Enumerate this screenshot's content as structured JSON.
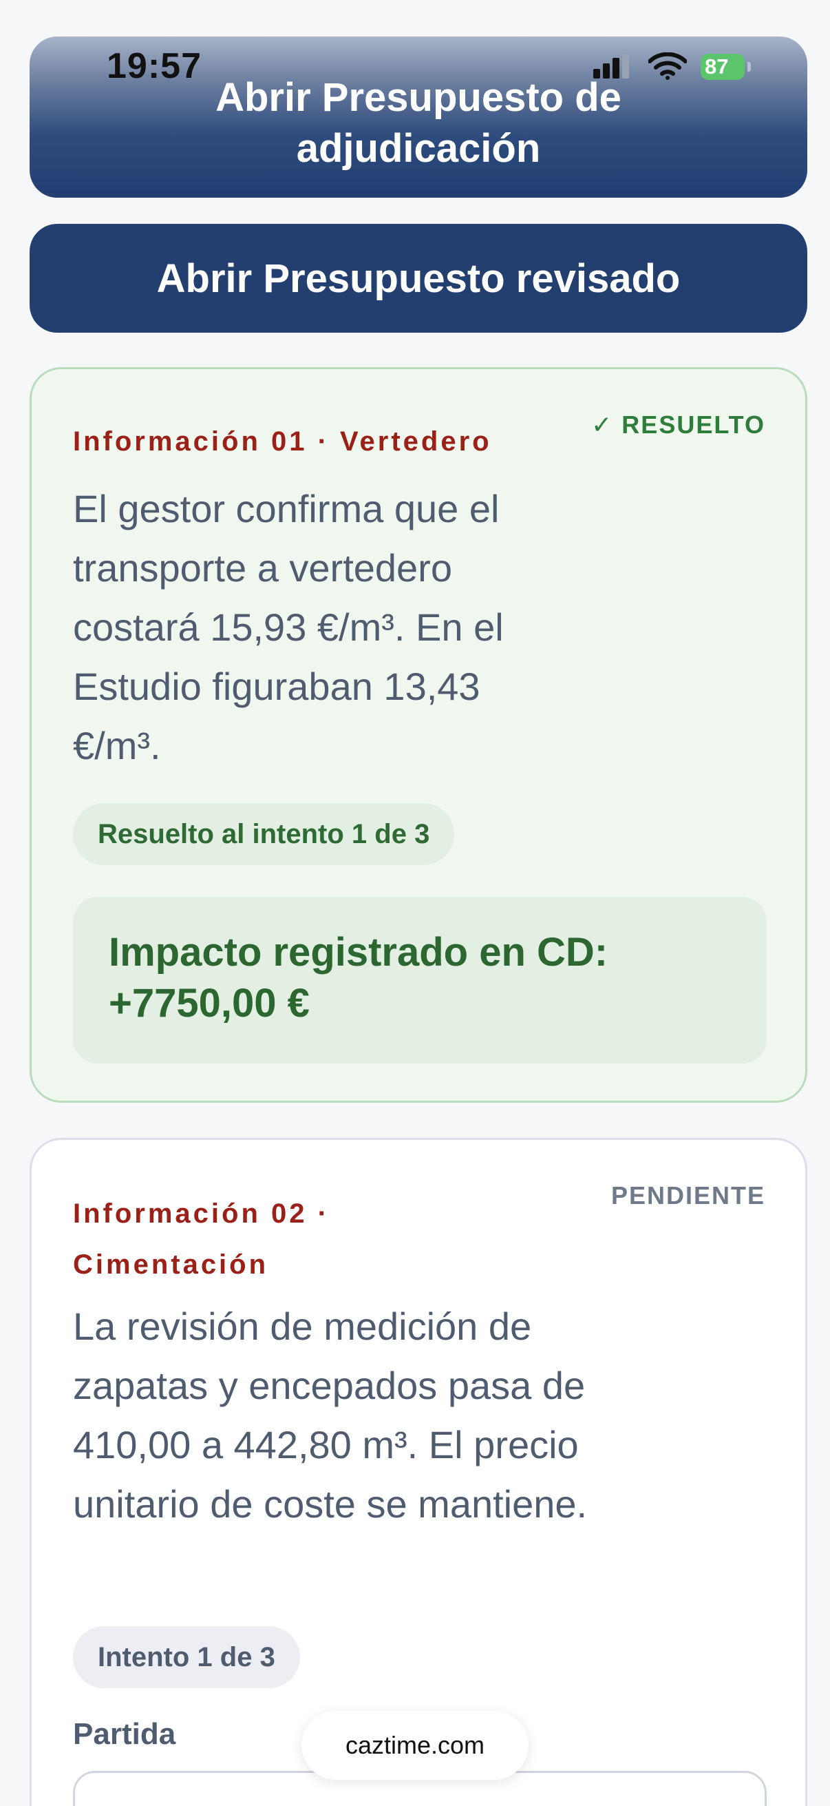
{
  "status_bar": {
    "time": "19:57",
    "battery": "87"
  },
  "buttons": {
    "open_adjudication": "Abrir Presupuesto de adjudicación",
    "open_revised": "Abrir Presupuesto revisado"
  },
  "cards": [
    {
      "kicker": "Información 01 · Vertedero",
      "status": "✓ RESUELTO",
      "body": "El gestor confirma que el transporte a vertedero costará 15,93 €/m³. En el Estudio figuraban 13,43 €/m³.",
      "attempt": "Resuelto al intento 1 de 3",
      "impact_line1": "Impacto registrado en CD:",
      "impact_line2": "+7750,00 €"
    },
    {
      "kicker": "Información 02 · Cimentación",
      "status": "PENDIENTE",
      "body": "La revisión de medición de zapatas y encepados pasa de 410,00 a 442,80 m³. El precio unitario de coste se mantiene.",
      "attempt": "Intento 1 de 3",
      "field_label": "Partida"
    }
  ],
  "browser": {
    "url": "caztime.com"
  },
  "colors": {
    "primary_navy": "#233f6f",
    "resolved_green": "#2e7d3a",
    "kicker_red": "#9a2018",
    "pending_gray": "#6e7989"
  }
}
